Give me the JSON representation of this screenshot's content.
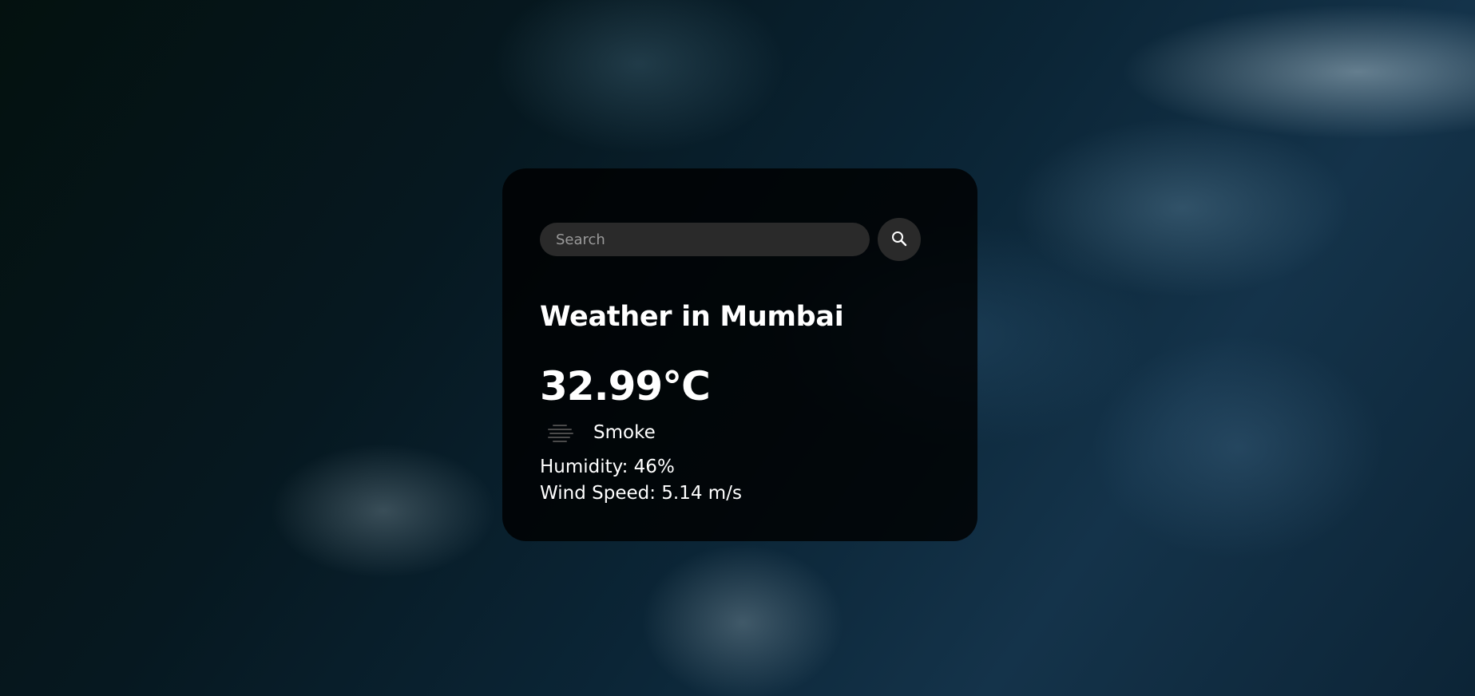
{
  "search": {
    "placeholder": "Search",
    "value": "",
    "button_icon": "search-icon"
  },
  "weather": {
    "title": "Weather in Mumbai",
    "temperature": "32.99°C",
    "condition": "Smoke",
    "condition_icon": "smoke-icon",
    "humidity": "Humidity: 46%",
    "wind_speed": "Wind Speed: 5.14 m/s"
  },
  "colors": {
    "card_background": "#000000",
    "input_background": "#2a2a2a",
    "text": "#ffffff"
  }
}
